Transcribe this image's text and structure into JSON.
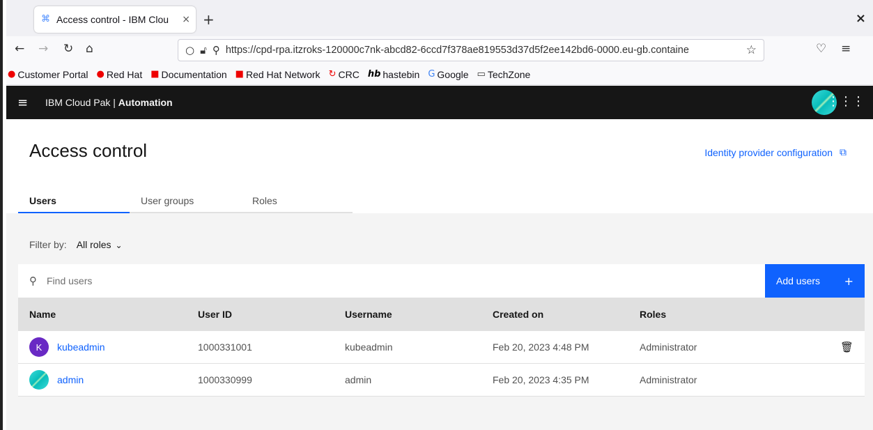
{
  "browser": {
    "tab_title": "Access control - IBM Clou",
    "tab_favicon": "cloud-pak-icon",
    "url": "https://cpd-rpa.itzroks-120000c7nk-abcd82-6ccd7f378ae819553d37d5f2ee142bd6-0000.eu-gb.containe",
    "bookmarks": [
      {
        "label": "Customer Portal",
        "icon": "redhat-icon",
        "glyph": "●",
        "color": "#ee0000"
      },
      {
        "label": "Red Hat",
        "icon": "redhat-icon",
        "glyph": "●",
        "color": "#ee0000"
      },
      {
        "label": "Documentation",
        "icon": "redhat-docs-icon",
        "glyph": "■",
        "color": "#ee0000"
      },
      {
        "label": "Red Hat Network",
        "icon": "redhat-network-icon",
        "glyph": "■",
        "color": "#ee0000"
      },
      {
        "label": "CRC",
        "icon": "crc-icon",
        "glyph": "↻",
        "color": "#ee0000"
      },
      {
        "label": "hastebin",
        "icon": "hastebin-icon",
        "glyph": "hb",
        "color": "#000000"
      },
      {
        "label": "Google",
        "icon": "google-icon",
        "glyph": "G",
        "color": "#4285f4"
      },
      {
        "label": "TechZone",
        "icon": "folder-icon",
        "glyph": "▭",
        "color": "#333333"
      }
    ]
  },
  "header": {
    "brand_prefix": "IBM Cloud Pak | ",
    "brand_bold": "Automation"
  },
  "page": {
    "title": "Access control",
    "idp_link": "Identity provider configuration",
    "tabs": [
      {
        "label": "Users",
        "active": true
      },
      {
        "label": "User groups",
        "active": false
      },
      {
        "label": "Roles",
        "active": false
      }
    ],
    "filter_label": "Filter by:",
    "filter_value": "All roles",
    "search_placeholder": "Find users",
    "add_button": "Add users",
    "columns": [
      "Name",
      "User ID",
      "Username",
      "Created on",
      "Roles"
    ],
    "rows": [
      {
        "initial": "K",
        "name": "kubeadmin",
        "user_id": "1000331001",
        "username": "kubeadmin",
        "created": "Feb 20, 2023 4:48 PM",
        "roles": "Administrator",
        "deletable": true
      },
      {
        "initial": "",
        "name": "admin",
        "user_id": "1000330999",
        "username": "admin",
        "created": "Feb 20, 2023 4:35 PM",
        "roles": "Administrator",
        "deletable": false
      }
    ]
  },
  "colors": {
    "accent": "#0f62fe",
    "header_bg": "#161616",
    "avatar_purple": "#6929c4"
  }
}
